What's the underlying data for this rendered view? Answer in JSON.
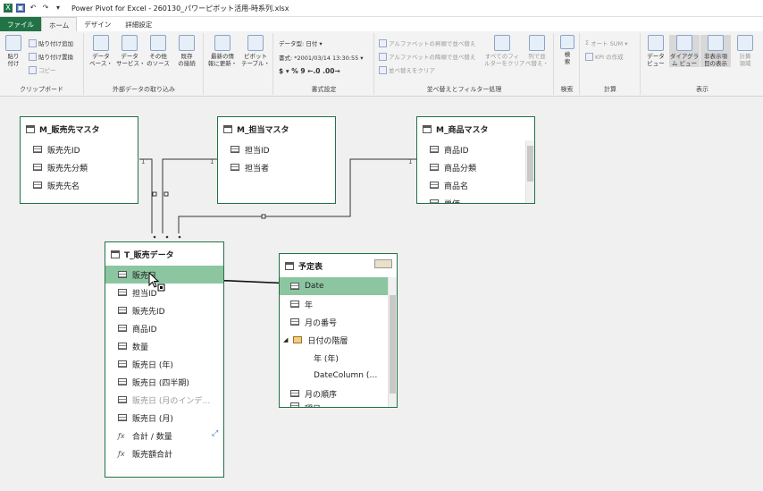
{
  "title": "Power Pivot for Excel - 260130_パワーピボット活用-時系列.xlsx",
  "tabs": [
    "ファイル",
    "ホーム",
    "デザイン",
    "詳細設定"
  ],
  "ribbon": {
    "clipboard": {
      "paste": "貼り\n付け",
      "paste_append": "貼り付け追加",
      "paste_replace": "貼り付け置換",
      "copy": "コピー",
      "label": "クリップボード"
    },
    "external": {
      "db": "データ\nベース・",
      "service": "データ\nサービス・",
      "other": "その他\nのソース",
      "existing": "既存\nの接続",
      "label": "外部データの取り込み"
    },
    "refresh": {
      "label": "最新の情\n報に更新・"
    },
    "pivot": {
      "label": "ピボット\nテーブル・"
    },
    "format": {
      "datatype": "データ型: 日付 ▾",
      "format": "書式: *2001/03/14 13:30:55 ▾",
      "symbols": "$ ▾  %  9  ←.0  .00→",
      "label": "書式設定"
    },
    "sort": {
      "asc": "アルファベットの昇順で並べ替え",
      "desc": "アルファベットの降順で並べ替え",
      "clear": "並べ替えをクリア",
      "clear_filter": "すべてのフィ\nルターをクリア",
      "by_col": "列で並\nべ替え・",
      "label": "並べ替えとフィルター処理"
    },
    "find": {
      "btn": "検\n索",
      "label": "検索"
    },
    "calc": {
      "autosum": "オート SUM ▾",
      "kpi": "KPI の作成",
      "label": "計算"
    },
    "view": {
      "data": "データ\nビュー",
      "diagram": "ダイアグラ\nム ビュー",
      "hidden": "非表示項\n目の表示",
      "area": "計算\n領域",
      "label": "表示"
    }
  },
  "tables": {
    "sales_master": {
      "name": "M_販売先マスタ",
      "rows": [
        "販売先ID",
        "販売先分類",
        "販売先名"
      ]
    },
    "staff_master": {
      "name": "M_担当マスタ",
      "rows": [
        "担当ID",
        "担当者"
      ]
    },
    "product_master": {
      "name": "M_商品マスタ",
      "rows": [
        "商品ID",
        "商品分類",
        "商品名",
        "単価"
      ]
    },
    "sales_data": {
      "name": "T_販売データ",
      "rows": [
        "販売日",
        "担当ID",
        "販売先ID",
        "商品ID",
        "数量",
        "販売日 (年)",
        "販売日 (四半期)",
        "販売日 (月のインデ…",
        "販売日 (月)"
      ],
      "measures": [
        "合計 / 数量",
        "販売額合計"
      ]
    },
    "plan": {
      "name": "予定表",
      "rows": [
        "Date",
        "年",
        "月の番号",
        "日付の階層",
        "年 (年)",
        "DateColumn (…",
        "月の順序",
        "曜日"
      ]
    }
  },
  "one": "1",
  "colors": {
    "accent": "#217346",
    "selected": "#8cc6a0"
  }
}
